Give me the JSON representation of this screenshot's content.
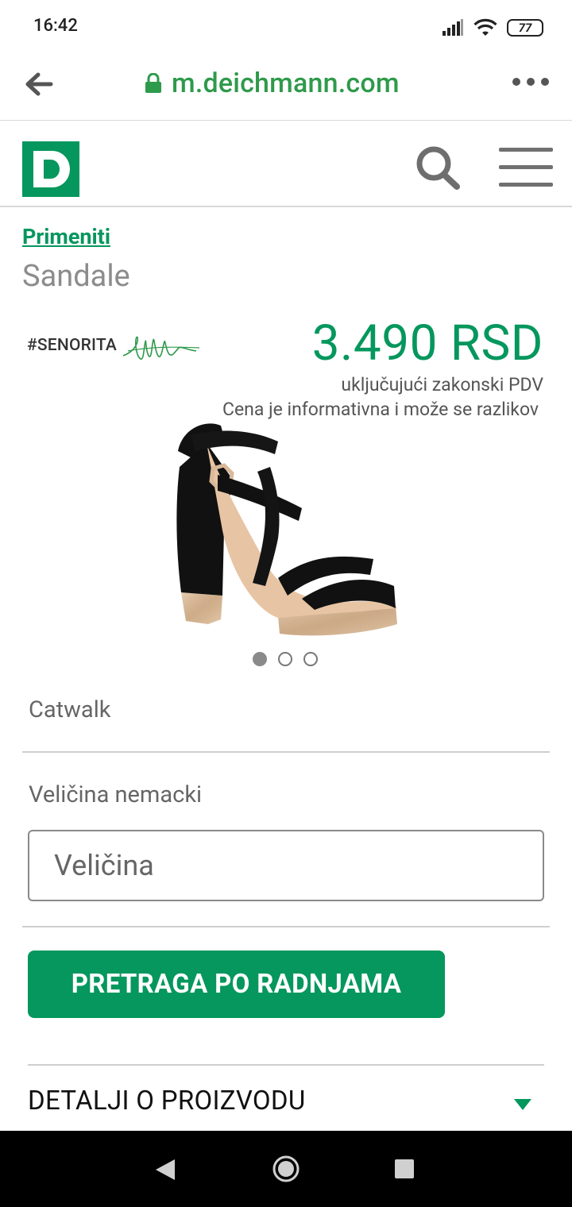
{
  "status_bar": {
    "time": "16:42",
    "battery": "77"
  },
  "browser": {
    "url": "m.deichmann.com"
  },
  "site_header": {
    "logo_letter": "D"
  },
  "product": {
    "breadcrumb": "Primeniti",
    "title": "Sandale",
    "brand_tag": "#SENORITA",
    "price": "3.490 RSD",
    "vat_note": "uključujući zakonski PDV",
    "info_note": "Cena je informativna i može se razlikov",
    "brand_name": "Catwalk",
    "image_count": 3,
    "active_image": 1
  },
  "size": {
    "label": "Veličina nemacki",
    "placeholder": "Veličina"
  },
  "actions": {
    "store_search": "PRETRAGA PO RADNJAMA"
  },
  "details": {
    "title": "DETALJI O PROIZVODU"
  },
  "colors": {
    "brand_green": "#05975d",
    "url_green": "#2e9a4b"
  }
}
